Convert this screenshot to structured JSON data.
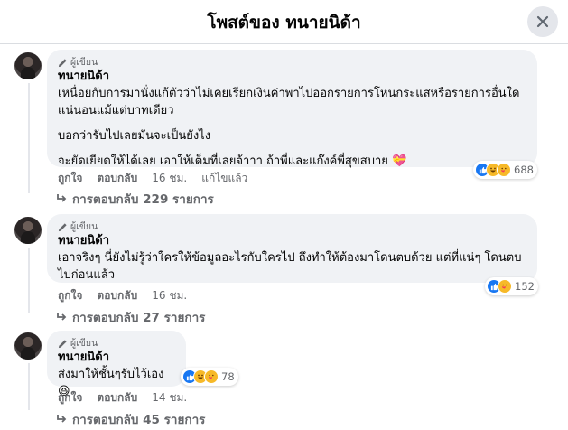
{
  "header": {
    "title": "โพสต์ของ ทนายนิด้า"
  },
  "comments": [
    {
      "badge": "ผู้เขียน",
      "author": "ทนายนิด้า",
      "paragraphs": [
        "เหนื่อยกับการมานั่งแก้ตัวว่าไม่เคยเรียกเงินค่าพาไปออกรายการโหนกระแสหรือรายการอื่นใด แน่นอนแม้แต่บาทเดียว",
        "บอกว่ารับไปเลยมันจะเป็นยังไง",
        "จะยัดเยียดให้ได้เลย เอาให้เต็มที่เลยจ้าาา ถ้าพี่และแก๊งค์พี่สุขสบาย 💝"
      ],
      "actions": {
        "like": "ถูกใจ",
        "reply": "ตอบกลับ",
        "time": "16 ชม.",
        "edited": "แก้ไขแล้ว"
      },
      "reaction_count": "688",
      "replies": "การตอบกลับ 229 รายการ"
    },
    {
      "badge": "ผู้เขียน",
      "author": "ทนายนิด้า",
      "paragraphs": [
        "เอาจริงๆ นี่ยังไม่รู้ว่าใครให้ข้อมูลอะไรกับใครไป ถึงทำให้ต้องมาโดนตบด้วย แต่ที่แน่ๆ โดนตบไปก่อนแล้ว"
      ],
      "actions": {
        "like": "ถูกใจ",
        "reply": "ตอบกลับ",
        "time": "16 ชม."
      },
      "reaction_count": "152",
      "replies": "การตอบกลับ 27 รายการ"
    },
    {
      "badge": "ผู้เขียน",
      "author": "ทนายนิด้า",
      "paragraphs": [
        "ส่งมาให้ชั้นๆรับไว้เอง 😆"
      ],
      "actions": {
        "like": "ถูกใจ",
        "reply": "ตอบกลับ",
        "time": "14 ชม."
      },
      "reaction_count": "78",
      "replies": "การตอบกลับ 45 รายการ"
    }
  ],
  "colors": {
    "like_blue": "#1877f2",
    "reaction_yellow": "#f7b928",
    "bubble_bg": "#f0f2f5",
    "meta_gray": "#65676b"
  }
}
